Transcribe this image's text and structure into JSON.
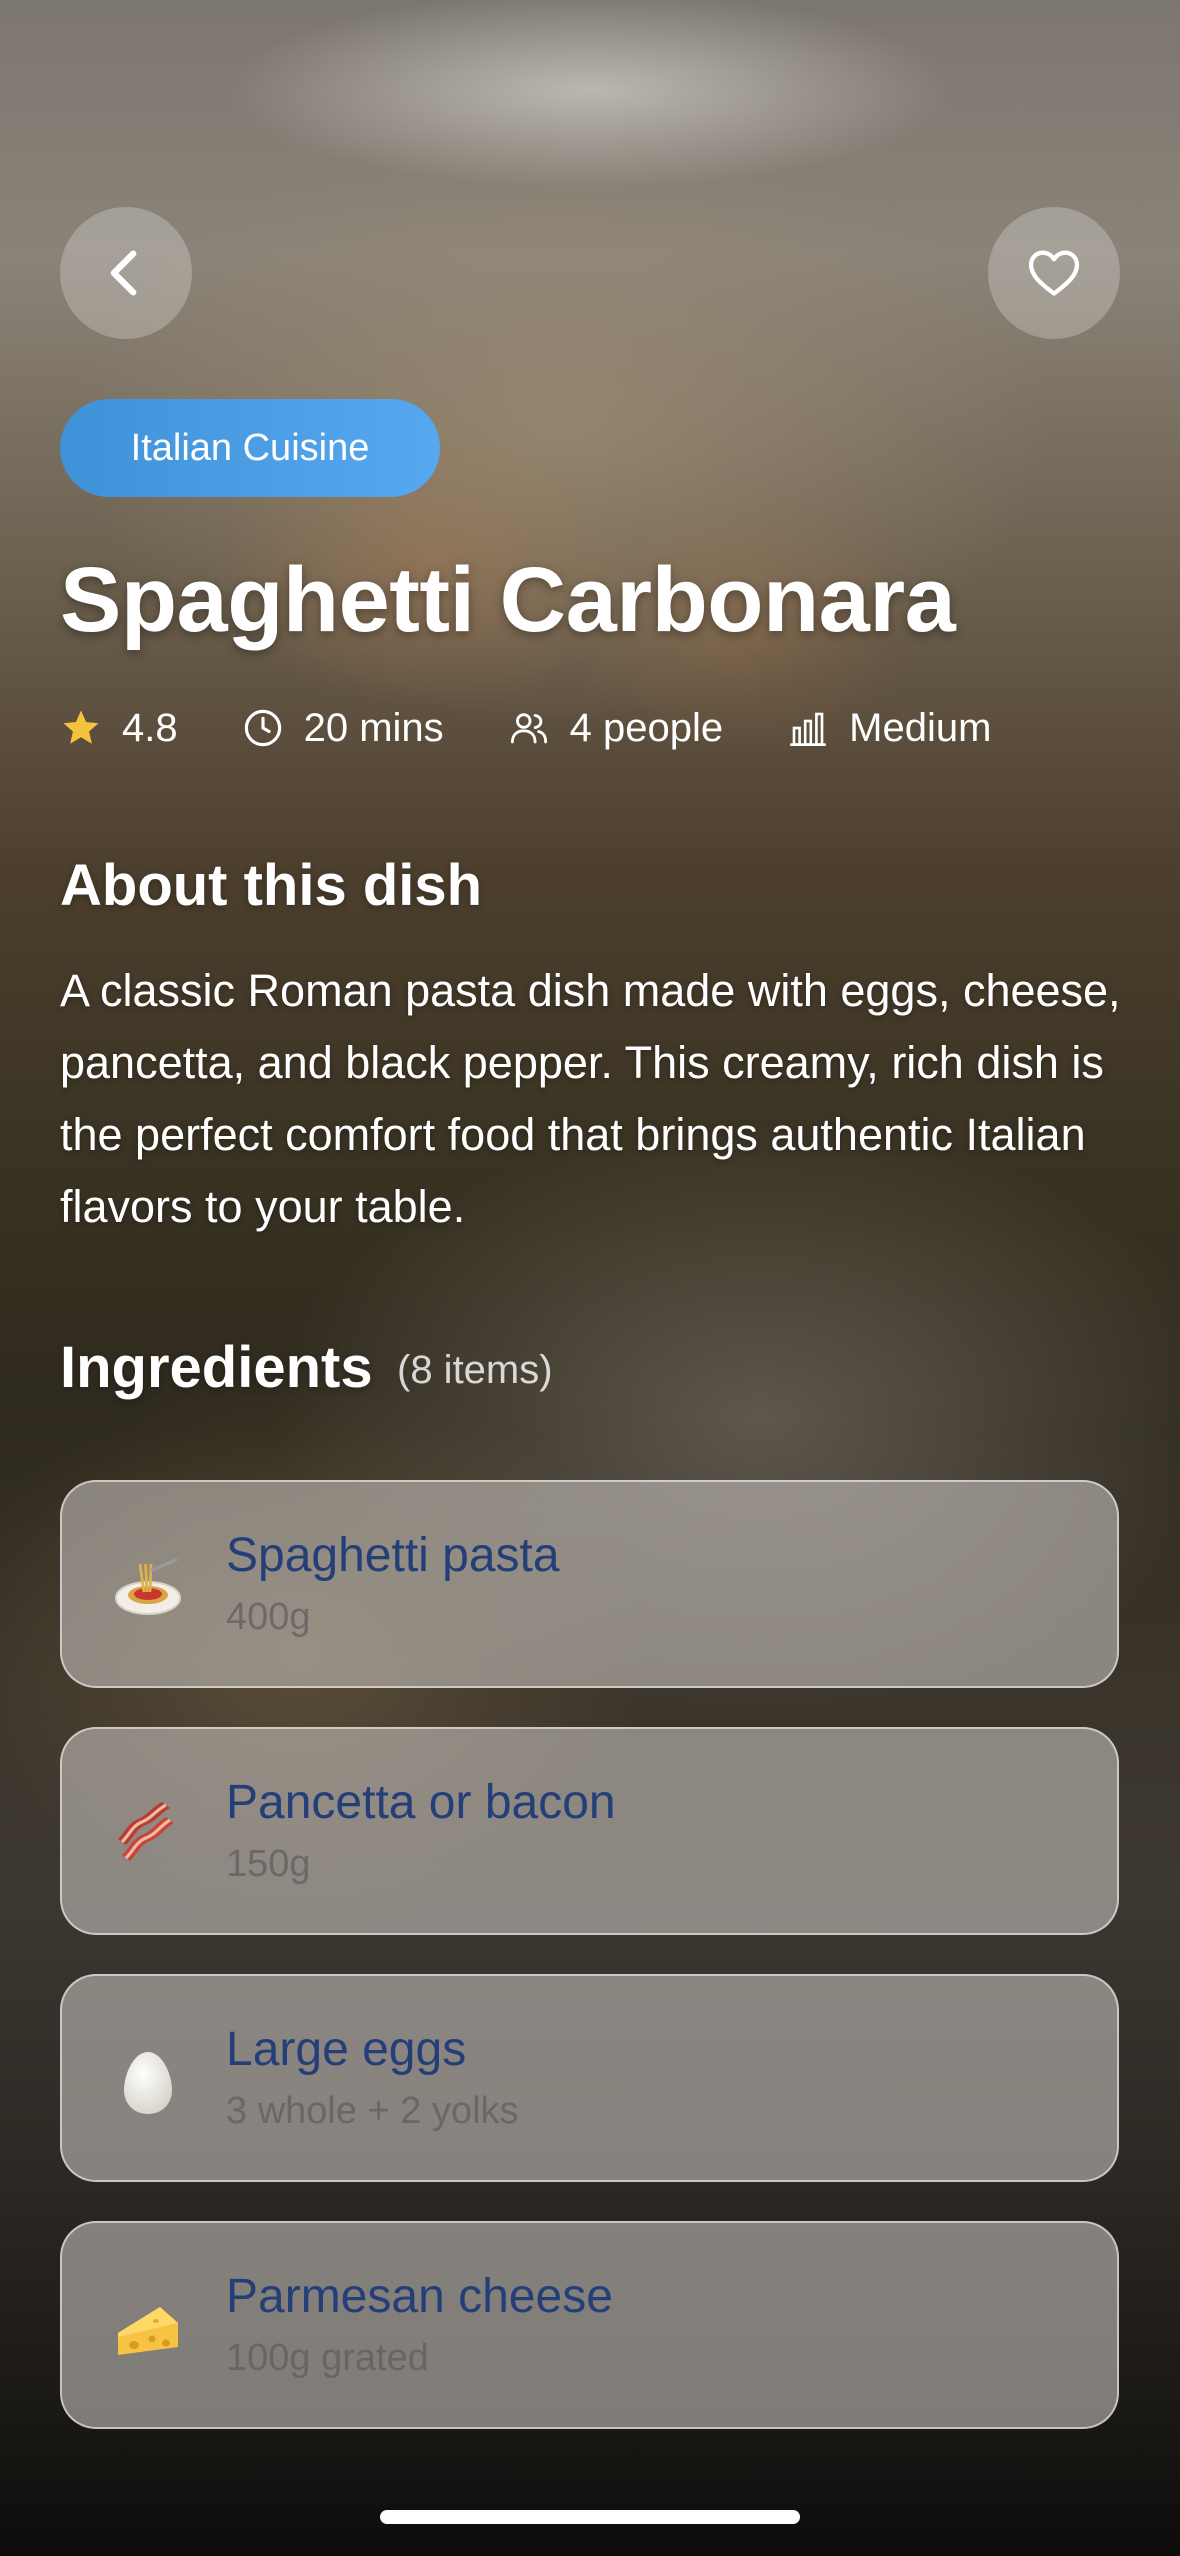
{
  "header": {
    "back_icon": "chevron-left-icon",
    "favorite_icon": "heart-icon"
  },
  "badge": {
    "label": "Italian Cuisine",
    "color": "#4a9de6"
  },
  "recipe": {
    "title": "Spaghetti Carbonara",
    "meta": {
      "rating": "4.8",
      "time": "20 mins",
      "servings": "4 people",
      "difficulty": "Medium"
    }
  },
  "about": {
    "heading": "About this dish",
    "text": "A classic Roman pasta dish made with eggs, cheese, pancetta, and black pepper. This creamy, rich dish is the perfect comfort food that brings authentic Italian flavors to your table."
  },
  "ingredients": {
    "heading": "Ingredients",
    "count": "(8 items)",
    "items": [
      {
        "name": "Spaghetti pasta",
        "qty": "400g",
        "icon": "spaghetti-icon"
      },
      {
        "name": "Pancetta or bacon",
        "qty": "150g",
        "icon": "bacon-icon"
      },
      {
        "name": "Large eggs",
        "qty": "3 whole + 2 yolks",
        "icon": "egg-icon"
      },
      {
        "name": "Parmesan cheese",
        "qty": "100g grated",
        "icon": "cheese-icon"
      }
    ]
  },
  "colors": {
    "accent": "#4a9de6",
    "ingredient_name": "#243f78",
    "star": "#f5c33b"
  }
}
